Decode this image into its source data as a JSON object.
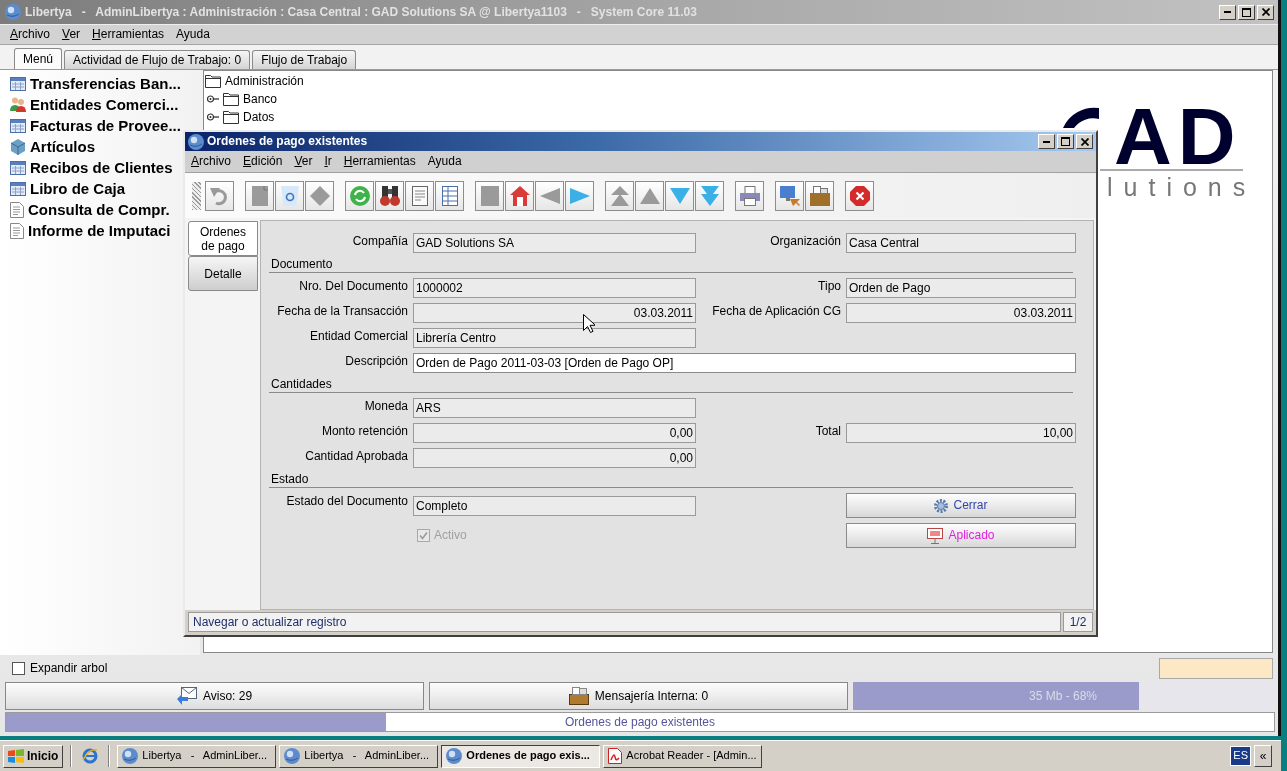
{
  "window": {
    "title": "Libertya   -   AdminLibertya : Administración : Casa Central : GAD Solutions SA @ Libertya1103   -   System Core 11.03"
  },
  "menu": [
    {
      "label": "Archivo",
      "mnemonic": true
    },
    {
      "label": "Ver",
      "mnemonic": true
    },
    {
      "label": "Herramientas",
      "mnemonic": true
    },
    {
      "label": "Ayuda",
      "mnemonic": false
    }
  ],
  "tabs": [
    {
      "label": "Menú",
      "selected": true
    },
    {
      "label": "Actividad de Flujo de Trabajo: 0",
      "selected": false
    },
    {
      "label": "Flujo de Trabajo",
      "selected": false
    }
  ],
  "sidebar": {
    "items": [
      {
        "label": "Transferencias Ban...",
        "kind": "window"
      },
      {
        "label": "Entidades Comerci...",
        "kind": "people"
      },
      {
        "label": "Facturas de Provee...",
        "kind": "window"
      },
      {
        "label": "Artículos",
        "kind": "product"
      },
      {
        "label": "Recibos de Clientes",
        "kind": "window"
      },
      {
        "label": "Libro de Caja",
        "kind": "window"
      },
      {
        "label": "Consulta de Compr.",
        "kind": "report"
      },
      {
        "label": "Informe de Imputaci",
        "kind": "report"
      }
    ]
  },
  "tree": {
    "label": "Administración",
    "children": [
      {
        "label": "Banco",
        "expanded": false
      },
      {
        "label": "Datos",
        "expanded": false
      }
    ]
  },
  "logo": {
    "letters": "AD",
    "tagline": "lutions"
  },
  "expand_tree": {
    "label": "Expandir arbol",
    "checked": false
  },
  "info_bar": {
    "notices": "Aviso: 29",
    "messages": "Mensajería Interna: 0",
    "memory": {
      "reading": "35 Mb - 68%",
      "level": 0.68
    }
  },
  "progress": {
    "label": "Ordenes de pago existentes",
    "level": 0.3
  },
  "dialog": {
    "title": "Ordenes de pago existentes",
    "menu": [
      {
        "label": "Archivo",
        "mnemonic": true
      },
      {
        "label": "Edición",
        "mnemonic": true
      },
      {
        "label": "Ver",
        "mnemonic": true
      },
      {
        "label": "Ir",
        "mnemonic": true
      },
      {
        "label": "Herramientas",
        "mnemonic": true
      },
      {
        "label": "Ayuda",
        "mnemonic": false
      }
    ],
    "toolbar": [
      [
        {
          "kind": "undo",
          "disabled": true
        }
      ],
      [
        {
          "kind": "new",
          "disabled": true
        },
        {
          "kind": "delete",
          "disabled": false
        },
        {
          "kind": "save",
          "disabled": true
        }
      ],
      [
        {
          "kind": "refresh",
          "disabled": false
        },
        {
          "kind": "find",
          "disabled": false
        },
        {
          "kind": "history",
          "disabled": false
        },
        {
          "kind": "grid",
          "disabled": false
        }
      ],
      [
        {
          "kind": "parent",
          "disabled": true
        },
        {
          "kind": "home",
          "disabled": false
        },
        {
          "kind": "back",
          "disabled": true
        },
        {
          "kind": "forward",
          "disabled": false
        }
      ],
      [
        {
          "kind": "first",
          "disabled": true
        },
        {
          "kind": "up",
          "disabled": true
        },
        {
          "kind": "down",
          "disabled": false
        },
        {
          "kind": "last",
          "disabled": false
        }
      ],
      [
        {
          "kind": "print",
          "disabled": false
        }
      ],
      [
        {
          "kind": "zoom",
          "disabled": false
        },
        {
          "kind": "archive",
          "disabled": false
        }
      ],
      [
        {
          "kind": "exit",
          "disabled": false
        }
      ]
    ],
    "tabs": [
      {
        "label": "Ordenes de pago",
        "selected": true
      },
      {
        "label": "Detalle",
        "selected": false
      }
    ],
    "form": [
      {
        "kind": "row",
        "cells": [
          {
            "kind": "field",
            "label": "Compañía",
            "value": "GAD Solutions SA",
            "numeric": false,
            "editable": false
          },
          {
            "kind": "field",
            "label": "Organización",
            "value": "Casa Central",
            "numeric": false,
            "editable": false
          }
        ]
      },
      {
        "kind": "section",
        "title": "Documento"
      },
      {
        "kind": "row",
        "cells": [
          {
            "kind": "field",
            "label": "Nro. Del Documento",
            "value": "1000002",
            "numeric": false,
            "editable": false
          },
          {
            "kind": "field",
            "label": "Tipo",
            "value": "Orden de Pago",
            "numeric": false,
            "editable": false
          }
        ]
      },
      {
        "kind": "row",
        "cells": [
          {
            "kind": "field",
            "label": "Fecha de la Transacción",
            "value": "03.03.2011",
            "numeric": true,
            "editable": false
          },
          {
            "kind": "field",
            "label": "Fecha de Aplicación CG",
            "value": "03.03.2011",
            "numeric": true,
            "editable": false
          }
        ]
      },
      {
        "kind": "row",
        "cells": [
          {
            "kind": "field",
            "label": "Entidad Comercial",
            "value": "Librería Centro",
            "numeric": false,
            "editable": false
          }
        ]
      },
      {
        "kind": "wide",
        "cells": [
          {
            "kind": "field",
            "label": "Descripción",
            "value": "Orden de Pago 2011-03-03 [Orden de Pago OP]",
            "numeric": false,
            "editable": true
          }
        ]
      },
      {
        "kind": "section",
        "title": "Cantidades"
      },
      {
        "kind": "row",
        "cells": [
          {
            "kind": "field",
            "label": "Moneda",
            "value": "ARS",
            "numeric": false,
            "editable": false
          }
        ]
      },
      {
        "kind": "row",
        "cells": [
          {
            "kind": "field",
            "label": "Monto retención",
            "value": "0,00",
            "numeric": true,
            "editable": false
          },
          {
            "kind": "field",
            "label": "Total",
            "value": "10,00",
            "numeric": true,
            "editable": false
          }
        ]
      },
      {
        "kind": "row",
        "cells": [
          {
            "kind": "field",
            "label": "Cantidad Aprobada",
            "value": "0,00",
            "numeric": true,
            "editable": false
          }
        ]
      },
      {
        "kind": "section",
        "title": "Estado"
      },
      {
        "kind": "row",
        "cells": [
          {
            "kind": "field",
            "label": "Estado del Documento",
            "value": "Completo",
            "numeric": false,
            "editable": false
          },
          {
            "kind": "process",
            "label": "Cerrar",
            "color": "#3344aa"
          }
        ]
      },
      {
        "kind": "row",
        "cells": [
          {
            "kind": "checkbox",
            "label": "Activo",
            "checked": true,
            "disabled": true
          },
          {
            "kind": "action",
            "label": "Aplicado",
            "color": "#dd22dd"
          }
        ]
      }
    ],
    "status": {
      "message": "Navegar o actualizar registro",
      "record": "1/2"
    }
  },
  "taskbar": {
    "start": "Inicio",
    "tasks": [
      {
        "label": "Libertya   -   AdminLiber...",
        "kind": "app",
        "selected": false
      },
      {
        "label": "Libertya   -   AdminLiber...",
        "kind": "app",
        "selected": false
      },
      {
        "label": "Ordenes de pago exis...",
        "kind": "app",
        "selected": true
      },
      {
        "label": "Acrobat Reader - [Admin...",
        "kind": "pdf",
        "selected": false
      }
    ],
    "language": "ES",
    "tray_toggle": "«"
  }
}
